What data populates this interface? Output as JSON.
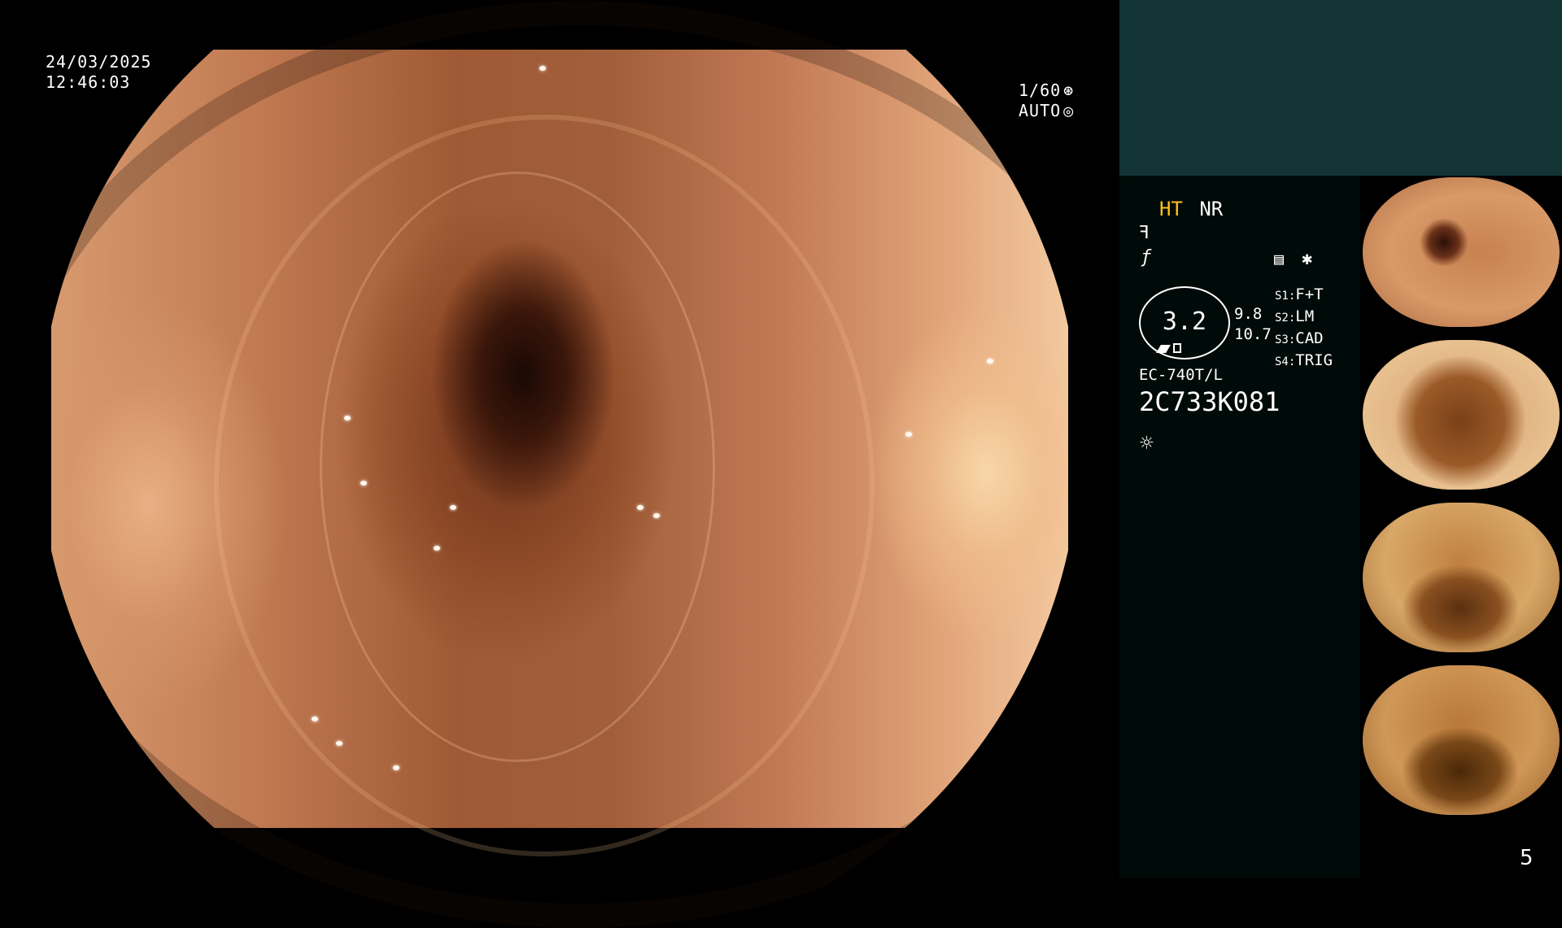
{
  "main_view": {
    "date": "24/03/2025",
    "time": "12:46:03",
    "shutter": "1/60",
    "exposure_mode": "AUTO"
  },
  "panel": {
    "mode_ht": "HT",
    "mode_nr": "NR",
    "gauge_value": "3.2",
    "gauge_side_top": "9.8",
    "gauge_side_bottom": "10.7",
    "switches": [
      {
        "key": "S1:",
        "value": "F+T"
      },
      {
        "key": "S2:",
        "value": "LM"
      },
      {
        "key": "S3:",
        "value": "CAD"
      },
      {
        "key": "S4:",
        "value": "TRIG"
      }
    ],
    "scope_model": "EC-740T/L",
    "serial": "2C733K081",
    "page_number": "5",
    "colors": {
      "highlight": "#ffc21a",
      "panel_top": "#123435",
      "panel_bg": "#000a08"
    },
    "icons": [
      "gear-fan-icon",
      "aperture-icon",
      "tilde-icon",
      "f-slash-icon",
      "settings-list-icon",
      "asterisk-icon",
      "light-icon"
    ]
  },
  "thumbnails": [
    {
      "serial": "2C733K081"
    },
    {
      "serial": "2C733K081"
    },
    {
      "serial": "2C733K081"
    },
    {
      "serial": "2C733K081"
    }
  ]
}
